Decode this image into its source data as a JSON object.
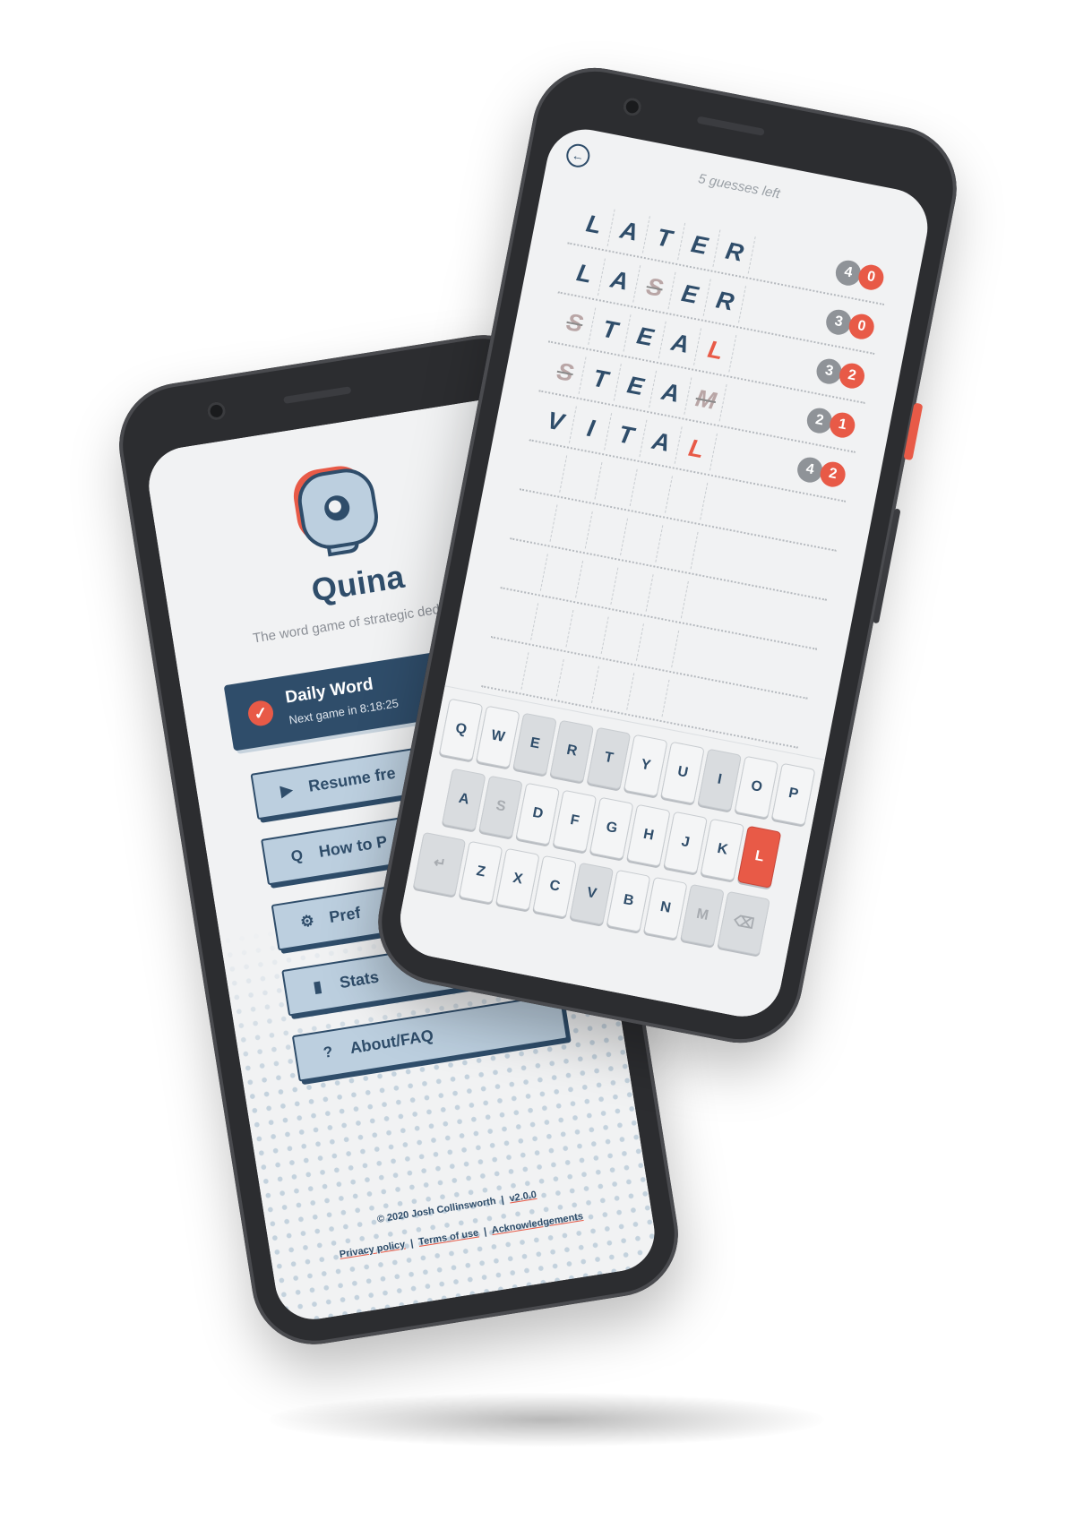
{
  "colors": {
    "navy": "#2f4d6a",
    "accent": "#e85a47",
    "button_fill": "#bccfdf",
    "score_grey": "#8f9398"
  },
  "menu_screen": {
    "app_name": "Quina",
    "tagline": "The word game of strategic deduction",
    "daily": {
      "title": "Daily Word",
      "subtitle": "Next game in 8:18:25",
      "icon": "check-icon"
    },
    "buttons": [
      {
        "label": "Resume fre",
        "icon": "play-icon",
        "glyph": "▶"
      },
      {
        "label": "How to P",
        "icon": "q-icon",
        "glyph": "Q"
      },
      {
        "label": "Pref",
        "icon": "gear-icon",
        "glyph": "⚙"
      },
      {
        "label": "Stats",
        "icon": "bar-chart-icon",
        "glyph": "▮"
      },
      {
        "label": "About/FAQ",
        "icon": "question-icon",
        "glyph": "?"
      }
    ],
    "footer": {
      "copyright": "© 2020 Josh Collinsworth",
      "separator": "|",
      "version": "v2.0.0",
      "links": [
        "Privacy policy",
        "Terms of use",
        "Acknowledgements"
      ]
    }
  },
  "game_screen": {
    "guesses_left": "5 guesses left",
    "guesses": [
      {
        "letters": [
          {
            "c": "L",
            "s": "n"
          },
          {
            "c": "A",
            "s": "n"
          },
          {
            "c": "T",
            "s": "n"
          },
          {
            "c": "E",
            "s": "n"
          },
          {
            "c": "R",
            "s": "n"
          }
        ],
        "score": [
          "4",
          "0"
        ]
      },
      {
        "letters": [
          {
            "c": "L",
            "s": "n"
          },
          {
            "c": "A",
            "s": "n"
          },
          {
            "c": "S",
            "s": "g"
          },
          {
            "c": "E",
            "s": "n"
          },
          {
            "c": "R",
            "s": "n"
          }
        ],
        "score": [
          "3",
          "0"
        ]
      },
      {
        "letters": [
          {
            "c": "S",
            "s": "g"
          },
          {
            "c": "T",
            "s": "n"
          },
          {
            "c": "E",
            "s": "n"
          },
          {
            "c": "A",
            "s": "n"
          },
          {
            "c": "L",
            "s": "r"
          }
        ],
        "score": [
          "3",
          "2"
        ]
      },
      {
        "letters": [
          {
            "c": "S",
            "s": "g"
          },
          {
            "c": "T",
            "s": "n"
          },
          {
            "c": "E",
            "s": "n"
          },
          {
            "c": "A",
            "s": "n"
          },
          {
            "c": "M",
            "s": "g"
          }
        ],
        "score": [
          "2",
          "1"
        ]
      },
      {
        "letters": [
          {
            "c": "V",
            "s": "n"
          },
          {
            "c": "I",
            "s": "n"
          },
          {
            "c": "T",
            "s": "n"
          },
          {
            "c": "A",
            "s": "n"
          },
          {
            "c": "L",
            "s": "r"
          }
        ],
        "score": [
          "4",
          "2"
        ]
      }
    ],
    "keyboard": {
      "rows": [
        [
          {
            "k": "Q"
          },
          {
            "k": "W"
          },
          {
            "k": "E",
            "st": "used"
          },
          {
            "k": "R",
            "st": "used"
          },
          {
            "k": "T",
            "st": "used"
          },
          {
            "k": "Y"
          },
          {
            "k": "U"
          },
          {
            "k": "I",
            "st": "used"
          },
          {
            "k": "O"
          },
          {
            "k": "P"
          }
        ],
        [
          {
            "k": "A",
            "st": "used"
          },
          {
            "k": "S",
            "st": "ghost"
          },
          {
            "k": "D"
          },
          {
            "k": "F"
          },
          {
            "k": "G"
          },
          {
            "k": "H"
          },
          {
            "k": "J"
          },
          {
            "k": "K"
          },
          {
            "k": "L",
            "st": "hot"
          }
        ],
        [
          {
            "k": "↵",
            "st": "ghost"
          },
          {
            "k": "Z"
          },
          {
            "k": "X"
          },
          {
            "k": "C"
          },
          {
            "k": "V",
            "st": "used"
          },
          {
            "k": "B"
          },
          {
            "k": "N"
          },
          {
            "k": "M",
            "st": "ghost"
          },
          {
            "k": "⌫",
            "st": "ghost"
          }
        ]
      ]
    }
  }
}
